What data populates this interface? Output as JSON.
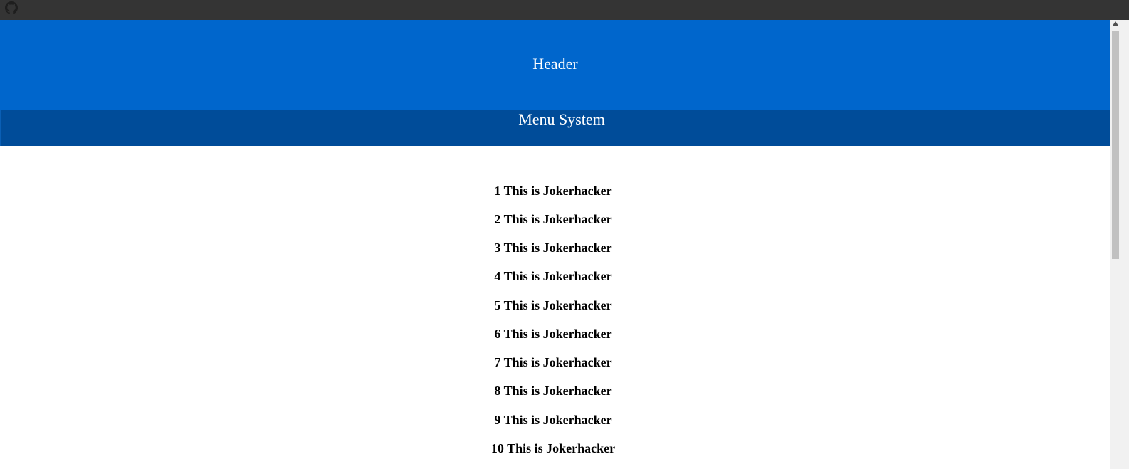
{
  "topbar": {
    "icon": "github-icon"
  },
  "header": {
    "title": "Header"
  },
  "menu": {
    "title": "Menu System"
  },
  "content": {
    "items": [
      "1 This is Jokerhacker",
      "2 This is Jokerhacker",
      "3 This is Jokerhacker",
      "4 This is Jokerhacker",
      "5 This is Jokerhacker",
      "6 This is Jokerhacker",
      "7 This is Jokerhacker",
      "8 This is Jokerhacker",
      "9 This is Jokerhacker",
      "10 This is Jokerhacker"
    ]
  },
  "colors": {
    "topbar": "#343434",
    "header": "#0066cc",
    "menu": "#004c99",
    "text_light": "#ffffff",
    "text_dark": "#000000"
  }
}
